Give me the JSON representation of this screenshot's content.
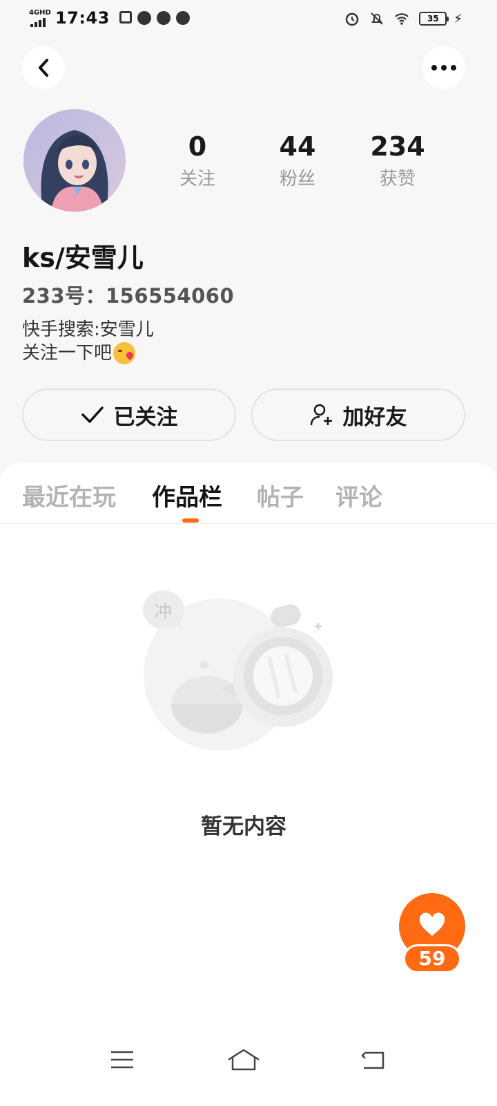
{
  "status_bar": {
    "network": "4GHD",
    "time": "17:43",
    "battery": "35"
  },
  "header": {
    "back_icon": "chevron-left-icon",
    "more_icon": "more-dots-icon"
  },
  "profile": {
    "stats": [
      {
        "value": "0",
        "label": "关注"
      },
      {
        "value": "44",
        "label": "粉丝"
      },
      {
        "value": "234",
        "label": "获赞"
      }
    ],
    "nickname": "ks/安雪儿",
    "uid": "233号：156554060",
    "bio_line1": "快手搜索:安雪儿",
    "bio_line2": "关注一下吧",
    "follow_label": "已关注",
    "add_friend_label": "加好友"
  },
  "tabs": [
    {
      "label": "最近在玩",
      "active": false
    },
    {
      "label": "作品栏",
      "active": true
    },
    {
      "label": "帖子",
      "active": false
    },
    {
      "label": "评论",
      "active": false
    }
  ],
  "empty_state": {
    "bubble_text": "冲",
    "text": "暂无内容"
  },
  "like_fab": {
    "count": "59",
    "accent": "#ff6a13"
  },
  "nav_bar": {
    "items": [
      "menu-icon",
      "home-icon",
      "back-icon"
    ]
  }
}
